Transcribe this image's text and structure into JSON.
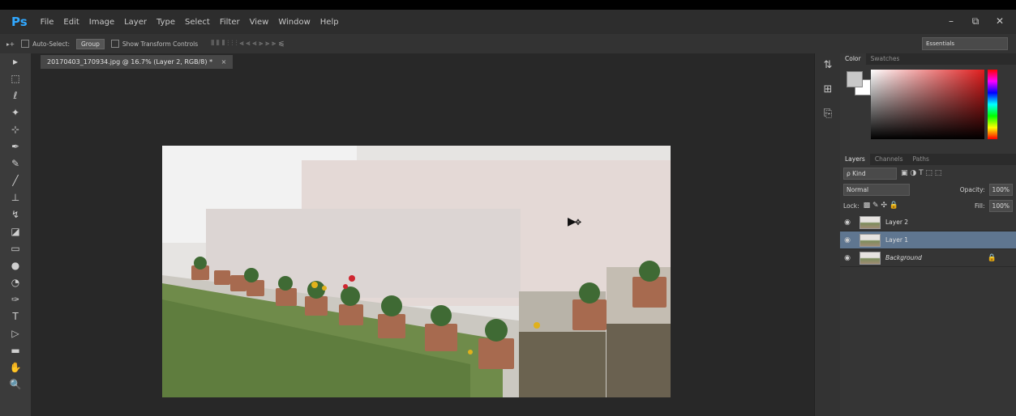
{
  "app": {
    "logo": "Ps"
  },
  "menu": [
    "File",
    "Edit",
    "Image",
    "Layer",
    "Type",
    "Select",
    "Filter",
    "View",
    "Window",
    "Help"
  ],
  "window_controls": {
    "minimize": "–",
    "restore": "⧉",
    "close": "✕"
  },
  "options": {
    "tool_glyph": "▸+",
    "auto_select": "Auto-Select:",
    "group": "Group",
    "transform": "Show Transform Controls",
    "align_glyphs": "⫴ ⫴ ⫴  ⫶ ⫶ ⫶  ⫷ ⫷ ⫷  ⫸ ⫸ ⫸  ⫹",
    "workspace": "Essentials"
  },
  "tools": [
    "▸",
    "⬚",
    "ℓ",
    "✦",
    "⊹",
    "✒",
    "✎",
    "╱",
    "⊥",
    "↯",
    "◪",
    "▭",
    "●",
    "◔",
    "✑",
    "T",
    "▷",
    "▬",
    "✋",
    "🔍"
  ],
  "document": {
    "tab_title": "20170403_170934.jpg @ 16.7% (Layer 2, RGB/8) *",
    "close": "×"
  },
  "dock_icons": [
    "⇅",
    "⊞",
    "⎘"
  ],
  "color_panel": {
    "tabs": [
      "Color",
      "Swatches"
    ],
    "fg": "#c8c8c8",
    "bg": "#ffffff"
  },
  "layers_panel": {
    "tabs": [
      "Layers",
      "Channels",
      "Paths"
    ],
    "filter": "ρ Kind",
    "filter_icons": "▣ ◑ T ⬚ ⬚",
    "blend_mode": "Normal",
    "opacity_label": "Opacity:",
    "opacity": "100%",
    "lock_label": "Lock:",
    "lock_icons": "▩ ✎ ✣ 🔒",
    "fill_label": "Fill:",
    "fill": "100%",
    "layers": [
      {
        "name": "Layer 2",
        "selected": false
      },
      {
        "name": "Layer 1",
        "selected": true
      },
      {
        "name": "Background",
        "selected": false,
        "locked": true
      }
    ]
  },
  "cursor": {
    "arrow": "▶",
    "move": "✥"
  }
}
